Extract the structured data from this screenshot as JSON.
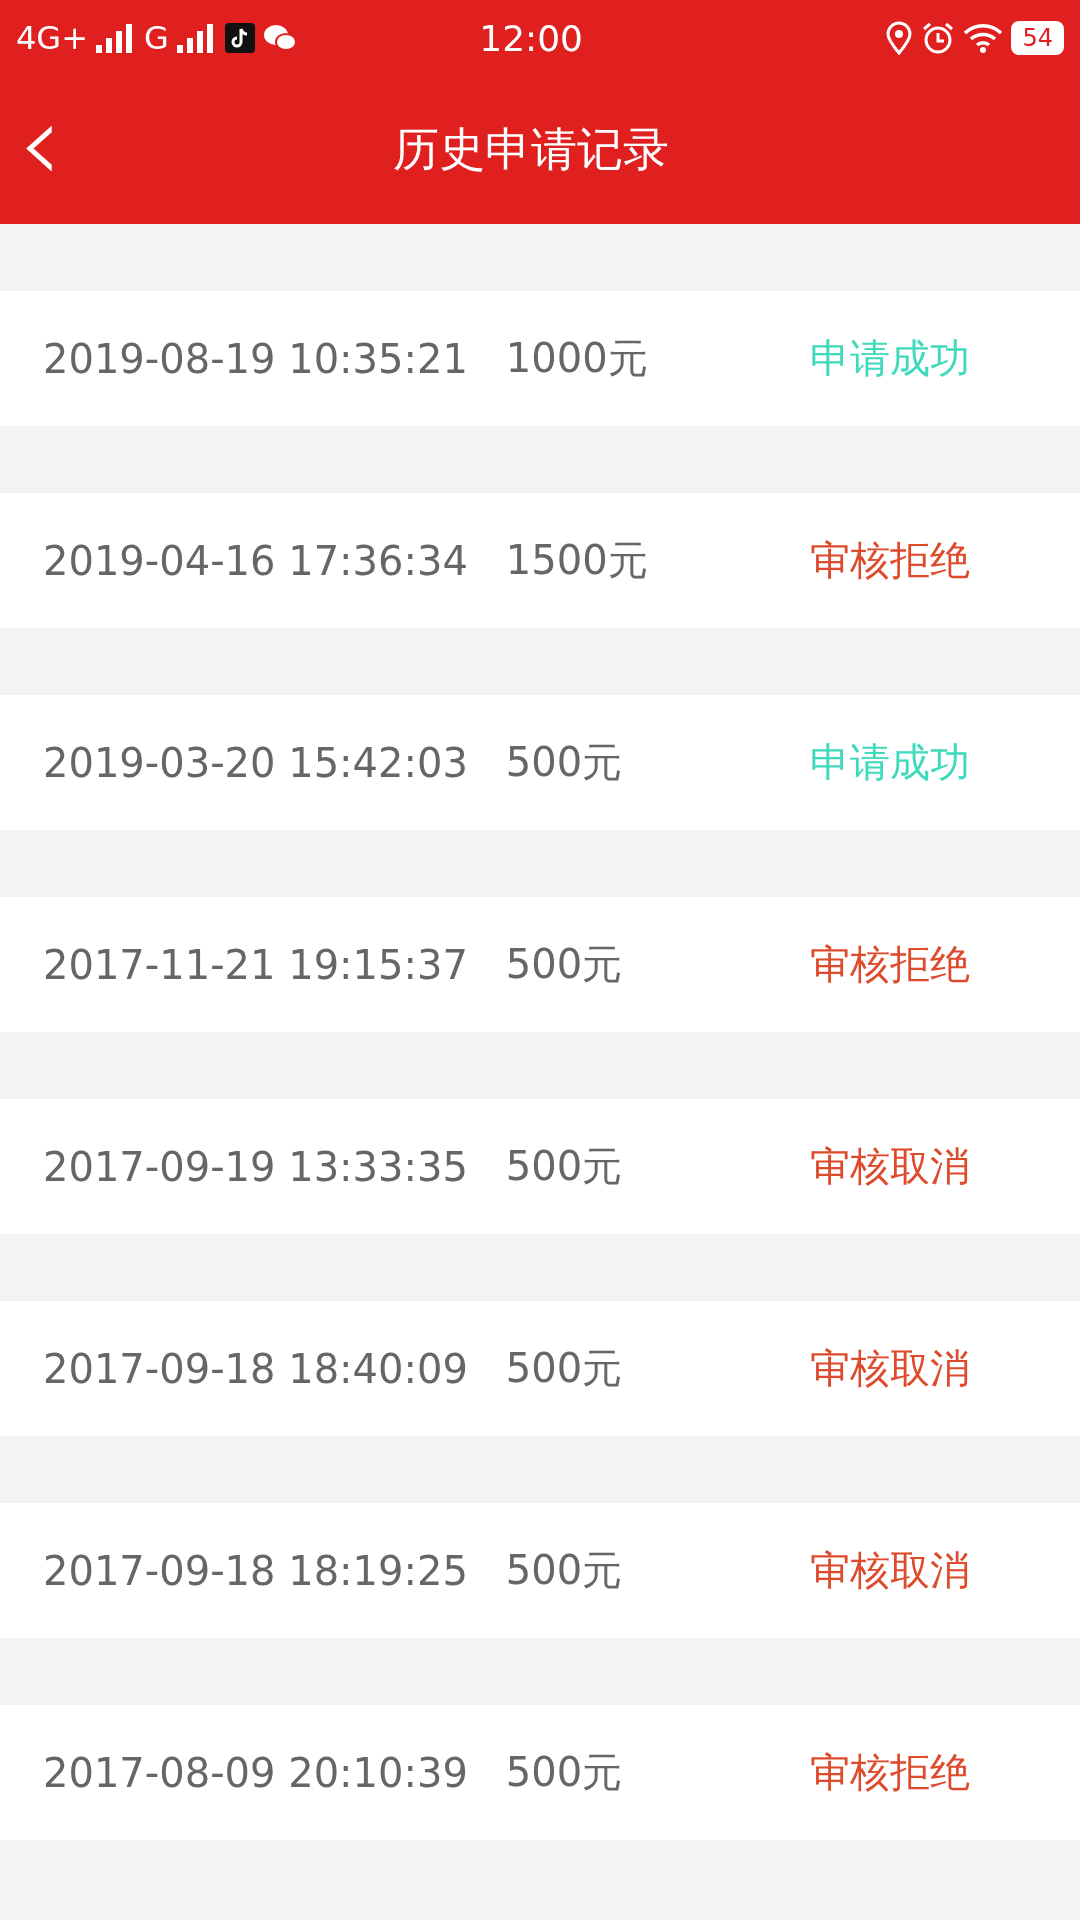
{
  "status_bar": {
    "network_1": "4G+",
    "network_2": "G",
    "time": "12:00",
    "battery": "54"
  },
  "header": {
    "back": "‹",
    "title": "历史申请记录"
  },
  "records": [
    {
      "datetime": "2019-08-19 10:35:21",
      "amount": "1000元",
      "status": "申请成功",
      "kind": "success"
    },
    {
      "datetime": "2019-04-16 17:36:34",
      "amount": "1500元",
      "status": "审核拒绝",
      "kind": "rejected"
    },
    {
      "datetime": "2019-03-20 15:42:03",
      "amount": "500元",
      "status": "申请成功",
      "kind": "success"
    },
    {
      "datetime": "2017-11-21 19:15:37",
      "amount": "500元",
      "status": "审核拒绝",
      "kind": "rejected"
    },
    {
      "datetime": "2017-09-19 13:33:35",
      "amount": "500元",
      "status": "审核取消",
      "kind": "cancelled"
    },
    {
      "datetime": "2017-09-18 18:40:09",
      "amount": "500元",
      "status": "审核取消",
      "kind": "cancelled"
    },
    {
      "datetime": "2017-09-18 18:19:25",
      "amount": "500元",
      "status": "审核取消",
      "kind": "cancelled"
    },
    {
      "datetime": "2017-08-09 20:10:39",
      "amount": "500元",
      "status": "审核拒绝",
      "kind": "rejected"
    }
  ]
}
